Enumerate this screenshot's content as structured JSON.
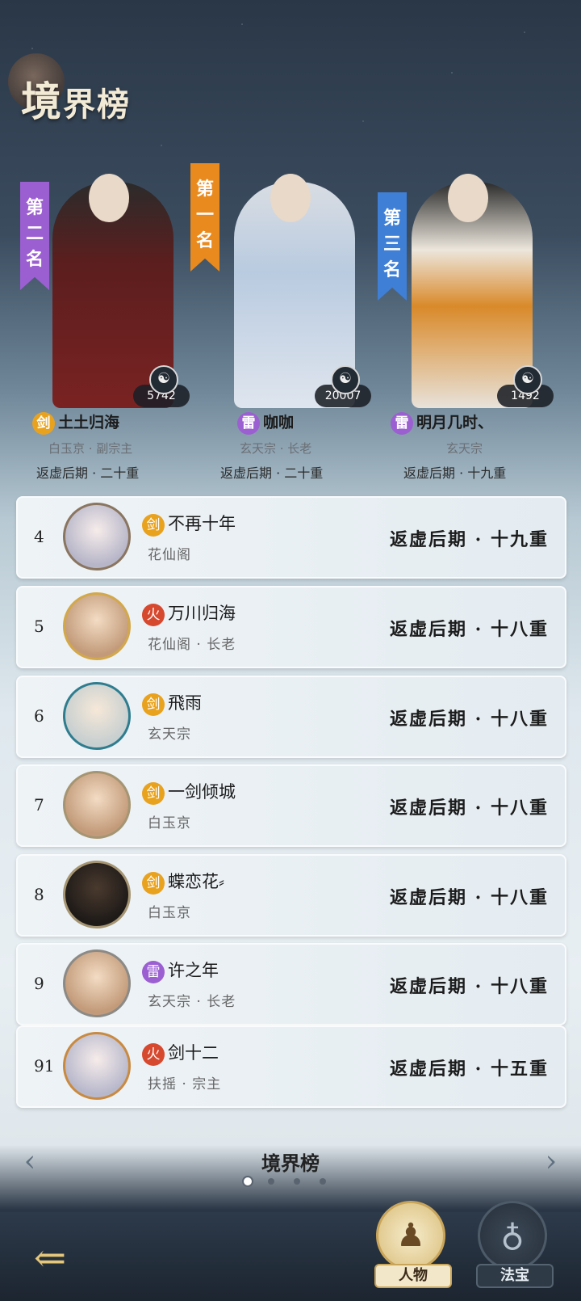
{
  "header": {
    "title_big": "境",
    "title_rest": "界榜"
  },
  "podium": [
    {
      "place_label": "第二名",
      "fans": "5742",
      "badge": "剑",
      "name": "土土归海",
      "sect": "白玉京 · 副宗主",
      "realm": "返虚后期 · 二十重",
      "banner_color": "#9b5fd1",
      "robe_color": "#7a2222"
    },
    {
      "place_label": "第一名",
      "fans": "20007",
      "badge": "雷",
      "name": "咖咖",
      "sect": "玄天宗 · 长老",
      "realm": "返虚后期 · 二十重",
      "banner_color": "#e98a1f",
      "robe_color": "#b9cbe0"
    },
    {
      "place_label": "第三名",
      "fans": "1492",
      "badge": "雷",
      "name": "明月几时、",
      "sect": "玄天宗",
      "realm": "返虚后期 · 十九重",
      "banner_color": "#3f7fd6",
      "robe_color": "#e8e2da"
    }
  ],
  "rows": [
    {
      "rank": "4",
      "badge": "剑",
      "name": "不再十年",
      "sect": "花仙阁",
      "realm": "返虚后期 · 十九重"
    },
    {
      "rank": "5",
      "badge": "火",
      "name": "万川归海",
      "sect": "花仙阁 · 长老",
      "realm": "返虚后期 · 十八重"
    },
    {
      "rank": "6",
      "badge": "剑",
      "name": "飛雨",
      "sect": "玄天宗",
      "realm": "返虚后期 · 十八重"
    },
    {
      "rank": "7",
      "badge": "剑",
      "name": "一剑倾城",
      "sect": "白玉京",
      "realm": "返虚后期 · 十八重"
    },
    {
      "rank": "8",
      "badge": "剑",
      "name": "蝶恋花⸗",
      "sect": "白玉京",
      "realm": "返虚后期 · 十八重"
    },
    {
      "rank": "9",
      "badge": "雷",
      "name": "许之年",
      "sect": "玄天宗 · 长老",
      "realm": "返虚后期 · 十八重"
    },
    {
      "rank": "91",
      "badge": "火",
      "name": "剑十二",
      "sect": "扶摇 · 宗主",
      "realm": "返虚后期 · 十五重"
    }
  ],
  "footer": {
    "title": "境界榜"
  },
  "tabs": {
    "person": "人物",
    "treasure": "法宝"
  },
  "colors": {
    "jian": "#e9a21d",
    "lei": "#9b5fd1",
    "huo": "#d6492f"
  }
}
